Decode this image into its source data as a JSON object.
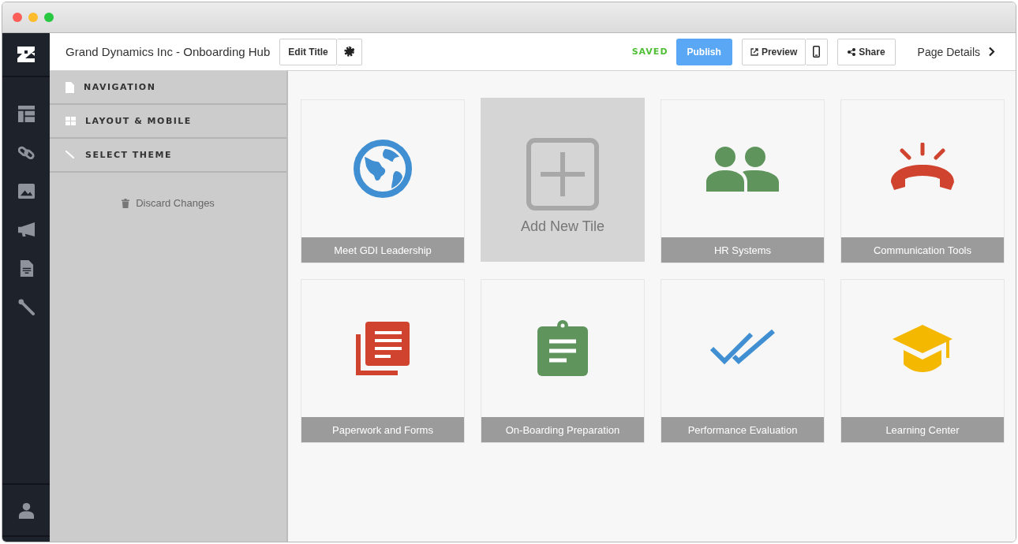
{
  "header": {
    "title": "Grand Dynamics Inc - Onboarding Hub",
    "edit_title": "Edit Title",
    "status": "SAVED",
    "publish": "Publish",
    "preview": "Preview",
    "share": "Share",
    "page_details": "Page Details"
  },
  "panel": {
    "sections": [
      {
        "label": "NAVIGATION",
        "kind": "page"
      },
      {
        "label": "LAYOUT & MOBILE",
        "kind": "grid"
      },
      {
        "label": "SELECT THEME",
        "kind": "brush"
      }
    ],
    "discard": "Discard Changes"
  },
  "tiles": [
    {
      "kind": "globe",
      "label": "Meet GDI Leadership",
      "color": "#3f8fd2"
    },
    {
      "kind": "add",
      "label": "Add New Tile"
    },
    {
      "kind": "people",
      "label": "HR Systems",
      "color": "#5f945c"
    },
    {
      "kind": "phone",
      "label": "Communication Tools",
      "color": "#d0432f"
    },
    {
      "kind": "documents",
      "label": "Paperwork and Forms",
      "color": "#d0432f"
    },
    {
      "kind": "clipboard",
      "label": "On-Boarding Preparation",
      "color": "#5f945c"
    },
    {
      "kind": "checks",
      "label": "Performance Evaluation",
      "color": "#3f8fd2"
    },
    {
      "kind": "cap",
      "label": "Learning Center",
      "color": "#f5b800"
    }
  ]
}
